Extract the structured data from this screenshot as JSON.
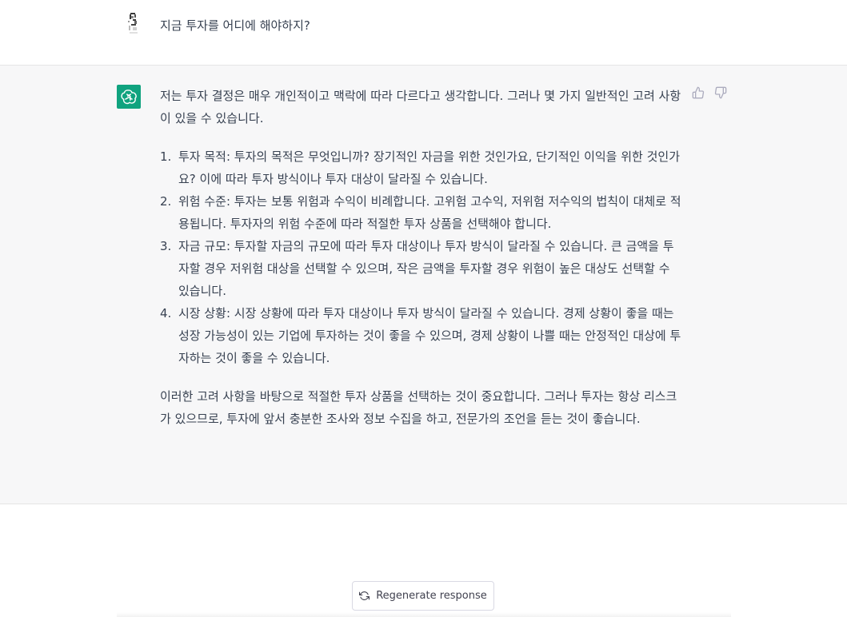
{
  "user": {
    "question": "지금 투자를 어디에 해야하지?"
  },
  "assistant": {
    "intro": "저는 투자 결정은 매우 개인적이고 맥락에 따라 다르다고 생각합니다. 그러나 몇 가지 일반적인 고려 사항이 있을 수 있습니다.",
    "items": [
      {
        "num": "1.",
        "text": "투자 목적: 투자의 목적은 무엇입니까? 장기적인 자금을 위한 것인가요, 단기적인 이익을 위한 것인가요? 이에 따라 투자 방식이나 투자 대상이 달라질 수 있습니다."
      },
      {
        "num": "2.",
        "text": "위험 수준: 투자는 보통 위험과 수익이 비례합니다. 고위험 고수익, 저위험 저수익의 법칙이 대체로 적용됩니다. 투자자의 위험 수준에 따라 적절한 투자 상품을 선택해야 합니다."
      },
      {
        "num": "3.",
        "text": "자금 규모: 투자할 자금의 규모에 따라 투자 대상이나 투자 방식이 달라질 수 있습니다. 큰 금액을 투자할 경우 저위험 대상을 선택할 수 있으며, 작은 금액을 투자할 경우 위험이 높은 대상도 선택할 수 있습니다."
      },
      {
        "num": "4.",
        "text": "시장 상황: 시장 상황에 따라 투자 대상이나 투자 방식이 달라질 수 있습니다. 경제 상황이 좋을 때는 성장 가능성이 있는 기업에 투자하는 것이 좋을 수 있으며, 경제 상황이 나쁠 때는 안정적인 대상에 투자하는 것이 좋을 수 있습니다."
      }
    ],
    "conclusion": "이러한 고려 사항을 바탕으로 적절한 투자 상품을 선택하는 것이 중요합니다. 그러나 투자는 항상 리스크가 있으므로, 투자에 앞서 충분한 조사와 정보 수집을 하고, 전문가의 조언을 듣는 것이 좋습니다."
  },
  "feedback": {
    "like_icon": "thumbs-up-icon",
    "dislike_icon": "thumbs-down-icon"
  },
  "regenerate": {
    "label": "Regenerate response",
    "icon": "refresh-icon"
  },
  "colors": {
    "accent": "#10a37f",
    "assistant_bg": "#f7f7f8",
    "text": "#374151"
  }
}
